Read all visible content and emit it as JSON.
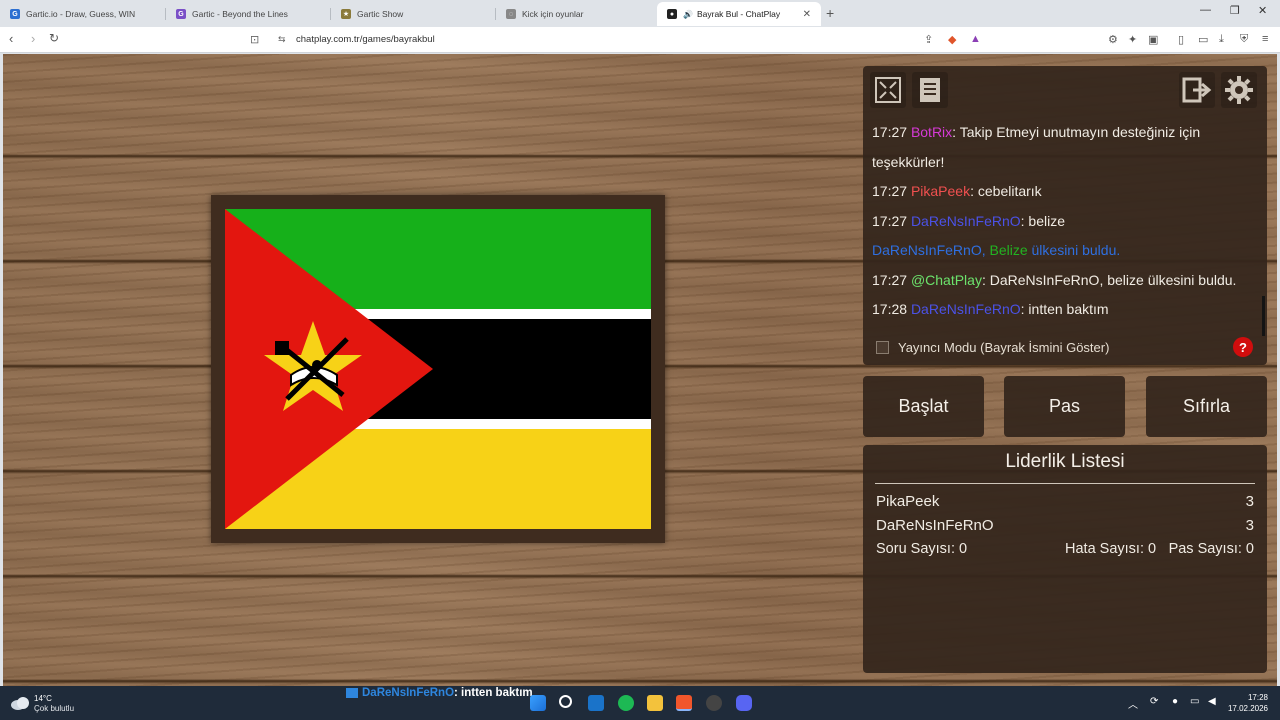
{
  "browser": {
    "tabs": [
      {
        "title": "Gartic.io - Draw, Guess, WIN",
        "icon": "gartic-io-icon",
        "color": "#2c6fd1",
        "glyph": "G"
      },
      {
        "title": "Gartic - Beyond the Lines",
        "icon": "gartic-icon",
        "color": "#7a4fc7",
        "glyph": "G"
      },
      {
        "title": "Gartic Show",
        "icon": "gartic-show-icon",
        "color": "#8a7a3a",
        "glyph": "★"
      },
      {
        "title": "Kick için oyunlar",
        "icon": "kick-icon",
        "color": "#888888",
        "glyph": "◌"
      },
      {
        "title": "Bayrak Bul - ChatPlay",
        "icon": "chatplay-icon",
        "color": "#222222",
        "glyph": "●",
        "active": true
      }
    ],
    "url": "chatplay.com.tr/games/bayrakbul"
  },
  "flag": {
    "country": "Mozambique",
    "colors": {
      "green": "#16b01a",
      "black": "#000000",
      "yellow": "#f7d217",
      "red": "#e3160f",
      "white": "#ffffff"
    }
  },
  "chat": {
    "messages": [
      {
        "time": "17:27",
        "user": "BotRix",
        "user_color": "#d63ad6",
        "text": ": Takip Etmeyi unutmayın desteğiniz için"
      },
      {
        "time": "",
        "user": "",
        "user_color": "",
        "text": "teşekkürler!"
      },
      {
        "time": "17:27",
        "user": "PikaPeek",
        "user_color": "#f05050",
        "text": ": cebelitarık"
      },
      {
        "time": "17:27",
        "user": "DaReNsInFeRnO",
        "user_color": "#4b52e6",
        "text": ": belize"
      },
      {
        "time": "17:27",
        "user": "@ChatPlay",
        "user_color": "#6ce36c",
        "text": ": DaReNsInFeRnO, belize ülkesini buldu."
      },
      {
        "time": "17:28",
        "user": "DaReNsInFeRnO",
        "user_color": "#4b52e6",
        "text": ": intten baktım"
      }
    ],
    "announcement": {
      "user": "DaReNsInFeRnO,",
      "country": "Belize",
      "rest": "ülkesini buldu.",
      "color": "#2f6fe0",
      "country_color": "#22b322"
    },
    "streamer_mode_label": "Yayıncı Modu (Bayrak İsmini Göster)",
    "help_label": "?"
  },
  "buttons": {
    "start": "Başlat",
    "pass": "Pas",
    "reset": "Sıfırla"
  },
  "leaderboard": {
    "title": "Liderlik Listesi",
    "rows": [
      {
        "name": "PikaPeek",
        "score": "3"
      },
      {
        "name": "DaReNsInFeRnO",
        "score": "3"
      }
    ],
    "question_count": "Soru Sayısı: 0",
    "error_count": "Hata Sayısı: 0",
    "pass_count": "Pas Sayısı: 0"
  },
  "taskbar": {
    "weather_temp": "14°C",
    "weather_desc": "Çok bulutlu",
    "notification_user": "DaReNsInFeRnO",
    "notification_text": ": intten baktım",
    "time": "17:28",
    "date": "17.02.2026"
  }
}
